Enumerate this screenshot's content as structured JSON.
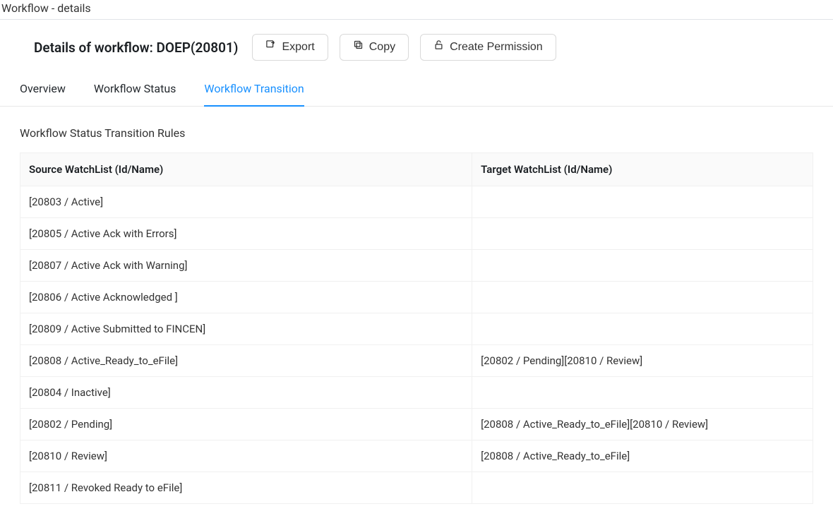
{
  "breadcrumb": "Workflow - details",
  "header": {
    "title": "Details of workflow: DOEP(20801)",
    "buttons": {
      "export": "Export",
      "copy": "Copy",
      "createPermission": "Create Permission"
    }
  },
  "tabs": [
    {
      "label": "Overview",
      "active": false
    },
    {
      "label": "Workflow Status",
      "active": false
    },
    {
      "label": "Workflow Transition",
      "active": true
    }
  ],
  "section": {
    "title": "Workflow Status Transition Rules",
    "columns": {
      "source": "Source WatchList (Id/Name)",
      "target": "Target WatchList (Id/Name)"
    },
    "rows": [
      {
        "source": "[20803 / Active]",
        "target": ""
      },
      {
        "source": "[20805 / Active Ack with Errors]",
        "target": ""
      },
      {
        "source": "[20807 / Active Ack with Warning]",
        "target": ""
      },
      {
        "source": "[20806 / Active Acknowledged ]",
        "target": ""
      },
      {
        "source": "[20809 / Active Submitted to FINCEN]",
        "target": ""
      },
      {
        "source": "[20808 / Active_Ready_to_eFile]",
        "target": "[20802 / Pending][20810 / Review]"
      },
      {
        "source": "[20804 / Inactive]",
        "target": ""
      },
      {
        "source": "[20802 / Pending]",
        "target": "[20808 / Active_Ready_to_eFile][20810 / Review]"
      },
      {
        "source": "[20810 / Review]",
        "target": "[20808 / Active_Ready_to_eFile]"
      },
      {
        "source": "[20811 / Revoked Ready to eFile]",
        "target": ""
      }
    ]
  }
}
